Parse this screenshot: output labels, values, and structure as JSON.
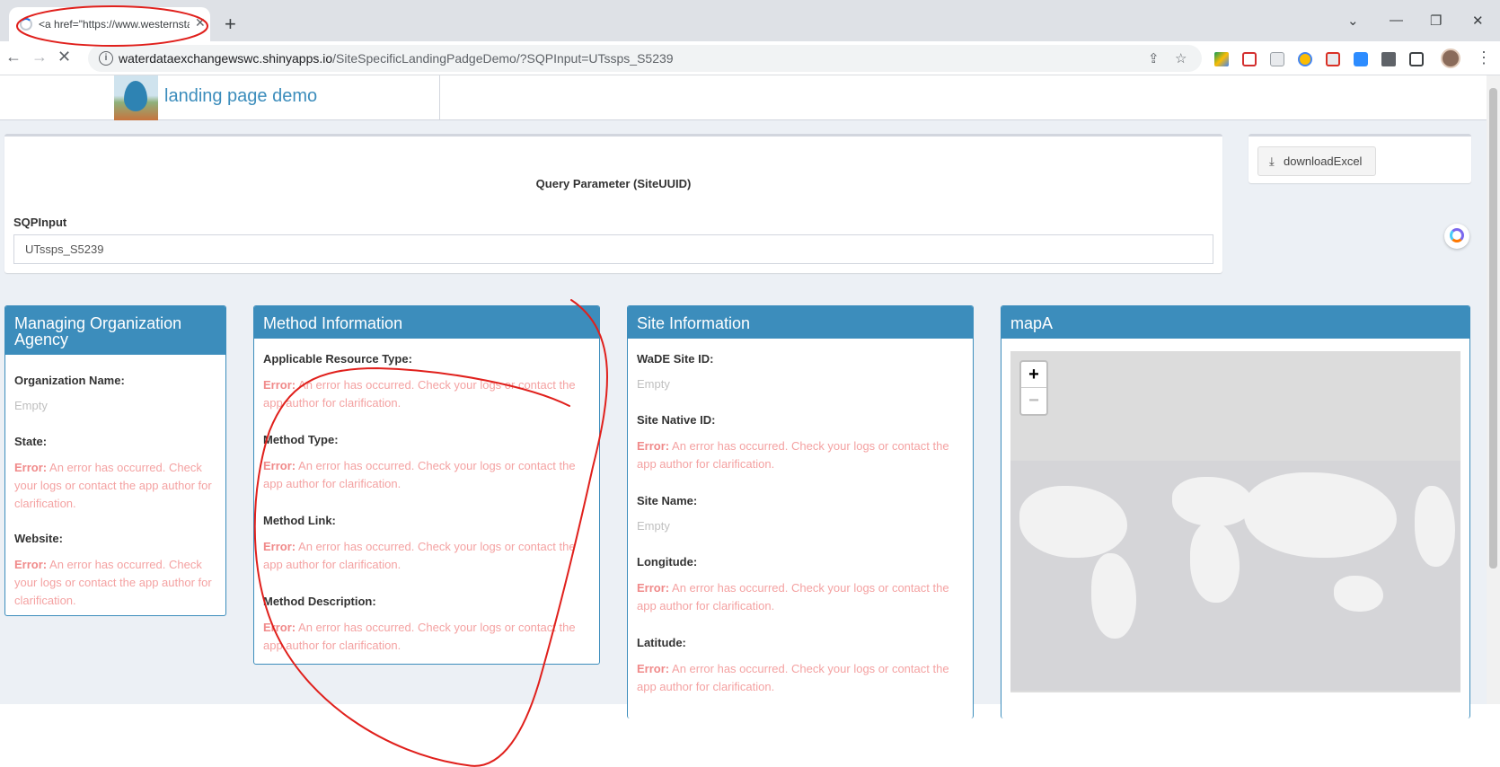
{
  "browser": {
    "tab_title": "<a href=\"https://www.westernstates",
    "url_host": "waterdataexchangewswc.shinyapps.io",
    "url_path": "/SiteSpecificLandingPadgeDemo/?SQPInput=UTssps_S5239"
  },
  "app": {
    "title": "landing page demo"
  },
  "query": {
    "title": "Query Parameter (SiteUUID)",
    "label": "SQPInput",
    "value": "UTssps_S5239"
  },
  "download": {
    "label": "downloadExcel"
  },
  "error": {
    "prefix": "Error:",
    "message": " An error has occurred. Check your logs or contact the app author for clarification."
  },
  "org": {
    "title": "Managing Organization Agency",
    "name_label": "Organization Name:",
    "name_value": "Empty",
    "state_label": "State:",
    "website_label": "Website:"
  },
  "method": {
    "title": "Method Information",
    "resource_label": "Applicable Resource Type:",
    "type_label": "Method Type:",
    "link_label": "Method Link:",
    "desc_label": "Method Description:"
  },
  "site": {
    "title": "Site Information",
    "wade_id_label": "WaDE Site ID:",
    "wade_id_value": "Empty",
    "native_id_label": "Site Native ID:",
    "name_label": "Site Name:",
    "name_value": "Empty",
    "longitude_label": "Longitude:",
    "latitude_label": "Latitude:"
  },
  "map": {
    "title": "mapA",
    "zoom_in": "+",
    "zoom_out": "−"
  },
  "colors": {
    "primary": "#3c8dbc",
    "error": "#f4a2a2",
    "annotation": "#e0201c"
  }
}
